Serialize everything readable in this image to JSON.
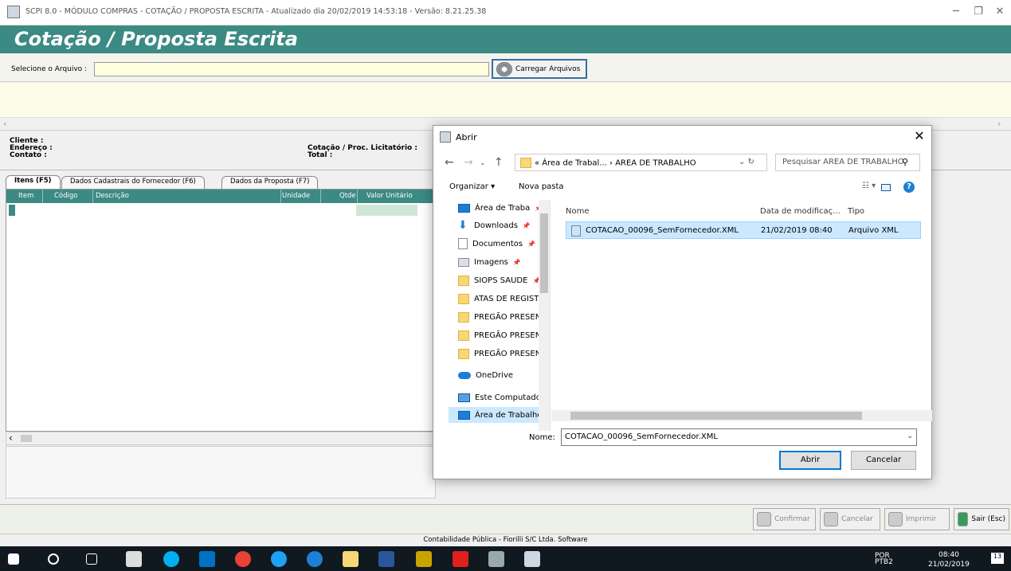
{
  "window": {
    "title": "SCPI 8.0 - MÓDULO COMPRAS - COTAÇÃO / PROPOSTA ESCRITA - Atualizado dia 20/02/2019 14:53:18 - Versão: 8.21.25.38"
  },
  "header": {
    "title": "Cotação / Proposta Escrita"
  },
  "file_bar": {
    "label": "Selecione o Arquivo :",
    "value": "",
    "load_button": "Carregar Arquivos"
  },
  "info": {
    "cliente": "Cliente :",
    "endereco": "Endereço :",
    "contato": "Contato :",
    "cotacao": "Cotação / Proc. Licitatório :",
    "total": "Total :"
  },
  "tabs": [
    "Itens (F5)",
    "Dados Cadastrais do Fornecedor (F6)",
    "Dados da Proposta (F7)"
  ],
  "grid": {
    "columns": [
      "Item",
      "Código",
      "Descrição",
      "Unidade",
      "Qtde",
      "Valor Unitário"
    ]
  },
  "bottom_buttons": {
    "confirm": "Confirmar",
    "cancel": "Cancelar",
    "print": "Imprimir",
    "exit": "Sair (Esc)"
  },
  "status": "Contabilidade Pública - Fiorilli S/C Ltda. Software",
  "dialog": {
    "title": "Abrir",
    "address": "« Área de Trabal... › AREA DE TRABALHO",
    "search_placeholder": "Pesquisar AREA DE TRABALHO",
    "organize": "Organizar ▾",
    "new_folder": "Nova pasta",
    "nav_items": [
      "Área de Traba",
      "Downloads",
      "Documentos",
      "Imagens",
      "SIOPS SAUDE",
      "ATAS DE REGISTI",
      "PREGÃO PRESEN",
      "PREGÃO PRESEN",
      "PREGÃO PRESEN",
      "OneDrive",
      "Este Computador",
      "Área de Trabalho"
    ],
    "columns": {
      "name": "Nome",
      "date": "Data de modificaç...",
      "type": "Tipo"
    },
    "file": {
      "name": "COTACAO_00096_SemFornecedor.XML",
      "date": "21/02/2019 08:40",
      "type": "Arquivo XML"
    },
    "name_label": "Nome:",
    "name_value": "COTACAO_00096_SemFornecedor.XML",
    "open_button": "Abrir",
    "cancel_button": "Cancelar"
  },
  "taskbar": {
    "lang": "POR",
    "layout": "PTB2",
    "time": "08:40",
    "date": "21/02/2019",
    "notif": "13"
  }
}
